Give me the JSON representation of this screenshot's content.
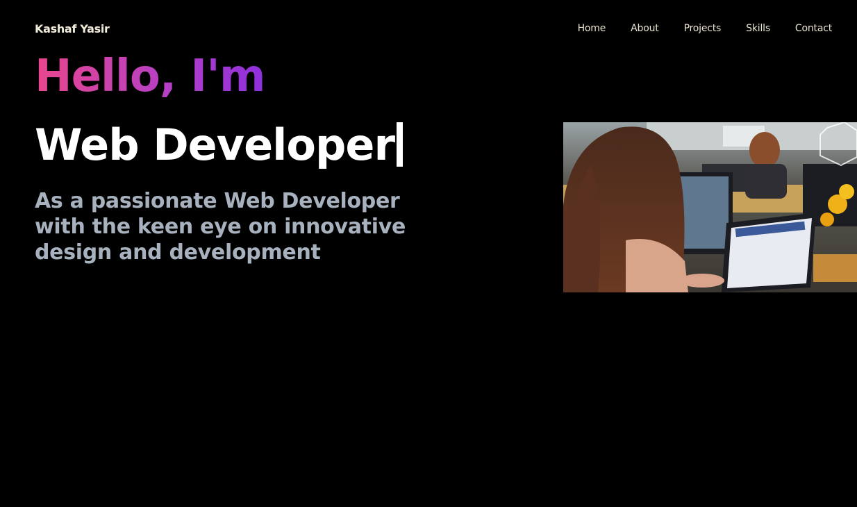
{
  "header": {
    "brand": "Kashaf Yasir",
    "nav": [
      "Home",
      "About",
      "Projects",
      "Skills",
      "Contact"
    ]
  },
  "hero": {
    "greeting": "Hello, I'm",
    "role": "Web Developer",
    "description": "As a passionate Web Developer with the keen eye on innovative design and development",
    "photo_icon": "office-photo-icon"
  },
  "colors": {
    "background": "#000000",
    "gradient_start": "#e9468c",
    "gradient_end": "#8e2fdc",
    "subtitle": "#a8b2bf"
  }
}
